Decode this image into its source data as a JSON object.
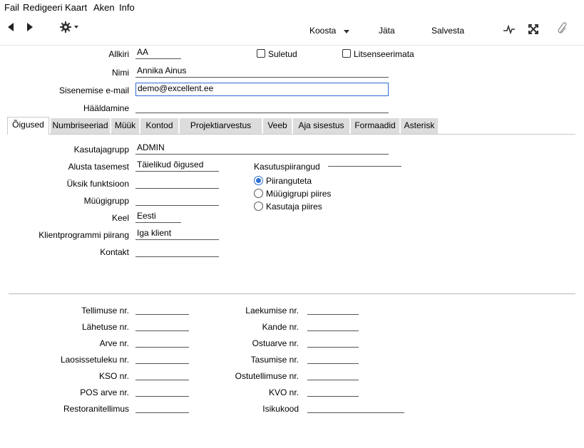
{
  "menu": [
    "Fail",
    "Redigeeri",
    "Kaart",
    "Aken",
    "Info"
  ],
  "toolbar": {
    "koosta": "Koosta",
    "jata": "Jäta",
    "salvesta": "Salvesta",
    "icons": [
      "prev-icon",
      "next-icon",
      "gear-icon",
      "pulse-icon",
      "expand-icon",
      "paperclip-icon"
    ]
  },
  "header": {
    "allkiri_label": "Allkiri",
    "allkiri_value": "AA",
    "suletud_label": "Suletud",
    "litsenseerimata_label": "Litsenseerimata",
    "nimi_label": "Nimi",
    "nimi_value": "Annika Ainus",
    "email_label": "Sisenemise e-mail",
    "email_value": "demo@excellent.ee",
    "haaldamine_label": "Hääldamine",
    "haaldamine_value": ""
  },
  "tabs": [
    "Õigused",
    "Numbriseeriad",
    "Müük",
    "Kontod",
    "Projektiarvestus",
    "Veeb",
    "Aja sisestus",
    "Formaadid",
    "Asterisk"
  ],
  "rights": {
    "kasutajagrupp_label": "Kasutajagrupp",
    "kasutajagrupp_value": "ADMIN",
    "alusta_label": "Alusta tasemest",
    "alusta_value": "Täielikud õigused",
    "uksik_label": "Üksik funktsioon",
    "uksik_value": "",
    "muugigrupp_label": "Müügigrupp",
    "muugigrupp_value": "",
    "keel_label": "Keel",
    "keel_value": "Eesti",
    "klient_label": "Klientprogrammi piirang",
    "klient_value": "Iga klient",
    "kontakt_label": "Kontakt",
    "kontakt_value": "",
    "piirangud_label": "Kasutuspiirangud",
    "radio": [
      "Piiranguteta",
      "Müügigrupi piires",
      "Kasutaja piires"
    ]
  },
  "numbers": {
    "left": [
      "Tellimuse nr.",
      "Lähetuse nr.",
      "Arve nr.",
      "Laosissetuleku nr.",
      "KSO nr.",
      "POS arve nr.",
      "Restoranitellimus"
    ],
    "right": [
      "Laekumise nr.",
      "Kande nr.",
      "Ostuarve nr.",
      "Tasumise nr.",
      "Ostutellimuse nr.",
      "KVO nr.",
      "Isikukood"
    ]
  },
  "colors": {
    "accent": "#2f6fd6",
    "tab_bg": "#dcdcdc"
  }
}
